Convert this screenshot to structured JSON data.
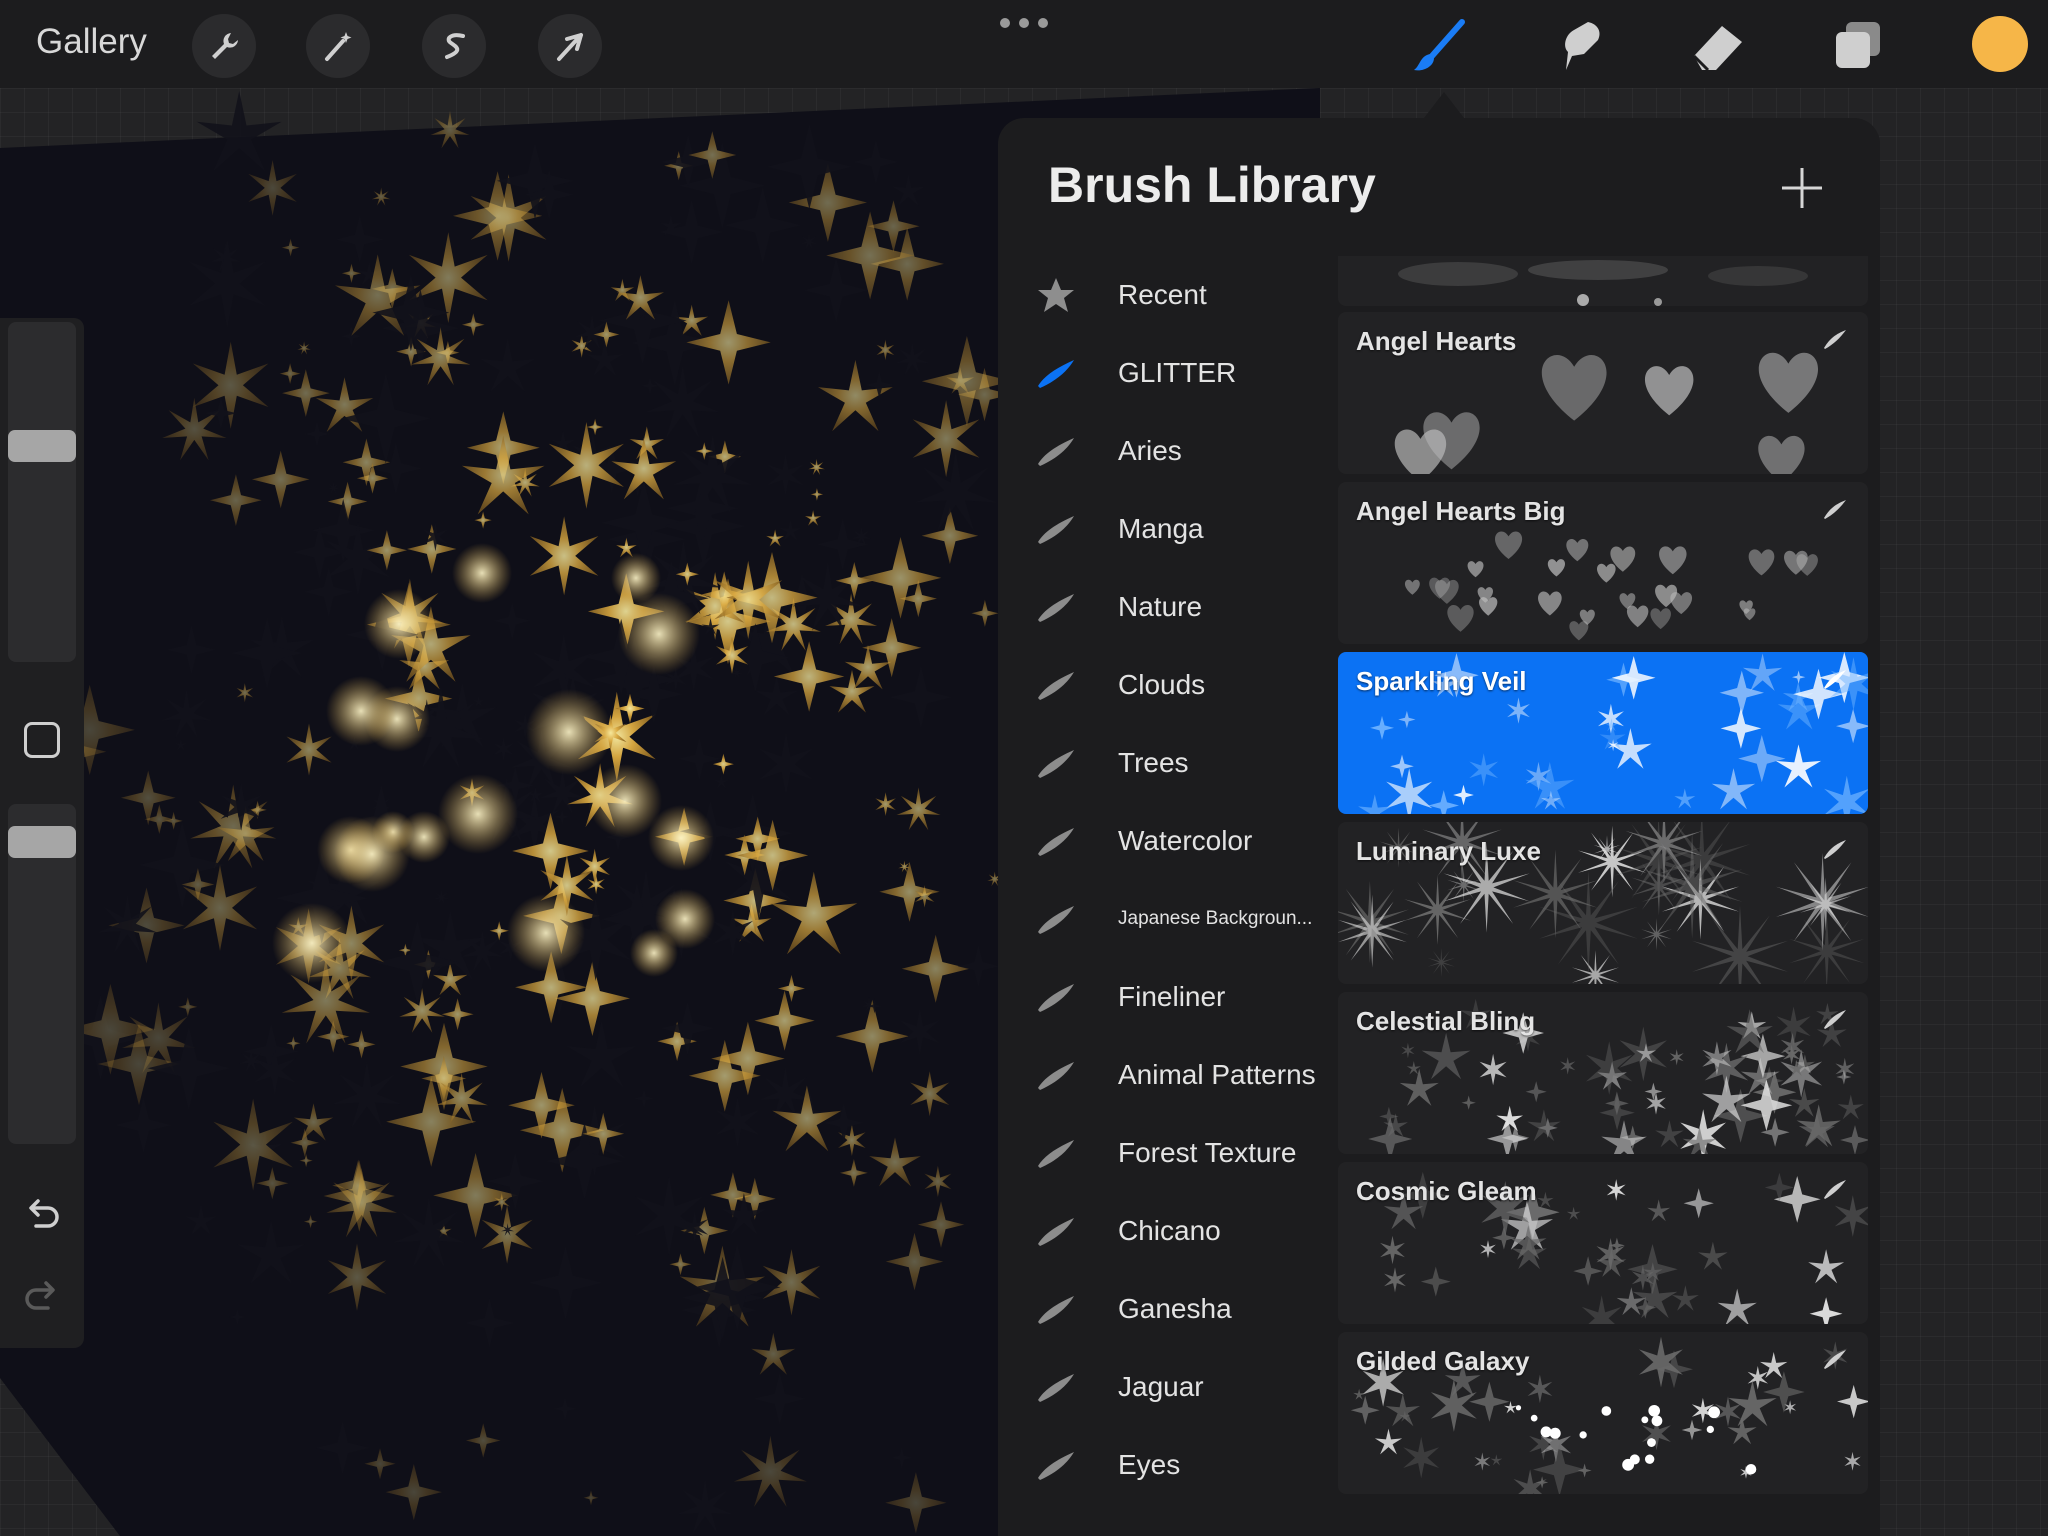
{
  "topbar": {
    "gallery_label": "Gallery",
    "left_tools": [
      {
        "name": "actions-wrench-icon"
      },
      {
        "name": "adjustments-wand-icon"
      },
      {
        "name": "selection-s-icon"
      },
      {
        "name": "transform-arrow-icon"
      }
    ],
    "right_tools": [
      {
        "name": "brush-icon",
        "active": true
      },
      {
        "name": "smudge-icon"
      },
      {
        "name": "eraser-icon"
      },
      {
        "name": "layers-icon"
      }
    ],
    "current_color": "#f6b648",
    "accent_color": "#0b72f4"
  },
  "brush_library": {
    "title": "Brush Library",
    "add_icon": "plus-icon",
    "brush_sets": [
      {
        "label": "Recent",
        "icon": "star-icon"
      },
      {
        "label": "GLITTER",
        "icon": "brush-stroke-icon",
        "selected": true
      },
      {
        "label": "Aries",
        "icon": "brush-stroke-icon"
      },
      {
        "label": "Manga",
        "icon": "brush-stroke-icon"
      },
      {
        "label": "Nature",
        "icon": "brush-stroke-icon"
      },
      {
        "label": "Clouds",
        "icon": "brush-stroke-icon"
      },
      {
        "label": "Trees",
        "icon": "brush-stroke-icon"
      },
      {
        "label": "Watercolor",
        "icon": "brush-stroke-icon"
      },
      {
        "label": "Japanese Backgroun...",
        "icon": "brush-stroke-icon"
      },
      {
        "label": "Fineliner",
        "icon": "brush-stroke-icon"
      },
      {
        "label": "Animal Patterns",
        "icon": "brush-stroke-icon"
      },
      {
        "label": "Forest Texture",
        "icon": "brush-stroke-icon"
      },
      {
        "label": "Chicano",
        "icon": "brush-stroke-icon"
      },
      {
        "label": "Ganesha",
        "icon": "brush-stroke-icon"
      },
      {
        "label": "Jaguar",
        "icon": "brush-stroke-icon"
      },
      {
        "label": "Eyes",
        "icon": "brush-stroke-icon"
      }
    ],
    "brushes": [
      {
        "label": "Angel Hearts",
        "preview": "hearts"
      },
      {
        "label": "Angel Hearts Big",
        "preview": "small-hearts"
      },
      {
        "label": "Sparkling Veil",
        "preview": "sparkles",
        "selected": true
      },
      {
        "label": "Luminary Luxe",
        "preview": "bursts"
      },
      {
        "label": "Celestial Bling",
        "preview": "dense-stars"
      },
      {
        "label": "Cosmic Gleam",
        "preview": "stars"
      },
      {
        "label": "Gilded Galaxy",
        "preview": "galaxy"
      }
    ]
  }
}
